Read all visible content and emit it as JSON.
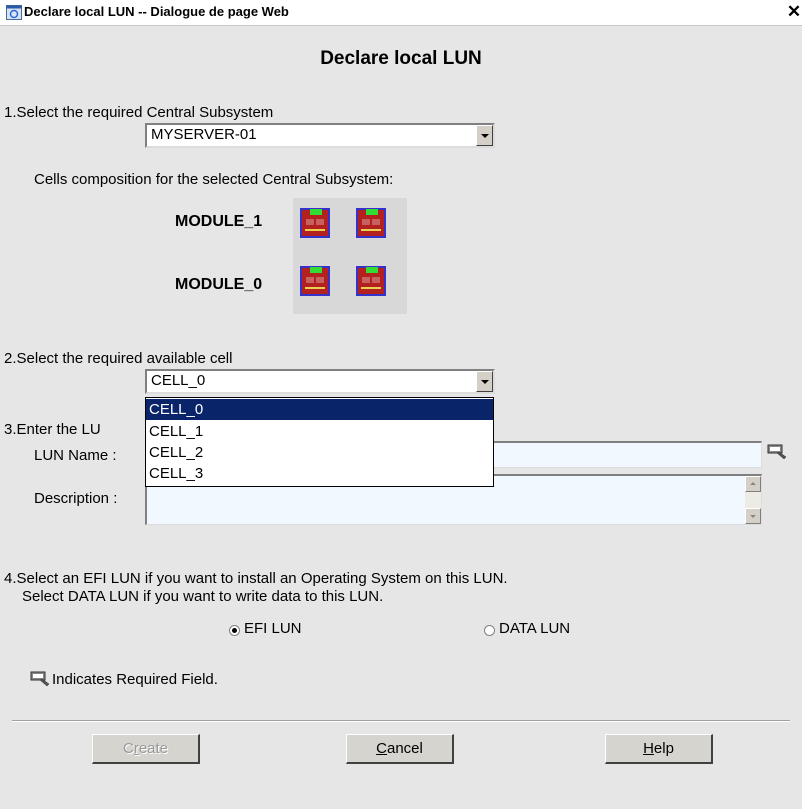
{
  "window": {
    "title": "Declare local LUN -- Dialogue de page Web"
  },
  "dialog": {
    "heading": "Declare local LUN"
  },
  "step1": {
    "label": "1.Select the required Central Subsystem",
    "selected": "MYSERVER-01",
    "composition_label": "Cells composition for the selected Central Subsystem:"
  },
  "modules": [
    {
      "name": "MODULE_1"
    },
    {
      "name": "MODULE_0"
    }
  ],
  "step2": {
    "label": "2.Select the required available cell",
    "selected": "CELL_0",
    "options": [
      "CELL_0",
      "CELL_1",
      "CELL_2",
      "CELL_3"
    ]
  },
  "step3": {
    "label_visible": "3.Enter the LU",
    "lun_name_label": "LUN Name :",
    "lun_name_value": "",
    "description_label": "Description :",
    "description_value": ""
  },
  "step4": {
    "line1": "4.Select an EFI LUN if you want to install an Operating System on this LUN.",
    "line2": "Select DATA LUN if you want to write data to this LUN.",
    "options": [
      {
        "label": "EFI LUN",
        "checked": true
      },
      {
        "label": "DATA LUN",
        "checked": false
      }
    ]
  },
  "required_note": "Indicates Required Field.",
  "buttons": {
    "create": {
      "prefix": "C",
      "underline": "r",
      "rest": "eate",
      "enabled": false
    },
    "cancel": {
      "underline": "C",
      "rest": "ancel",
      "enabled": true
    },
    "help": {
      "underline": "H",
      "rest": "elp",
      "enabled": true
    }
  },
  "icons": {
    "titlebar": "ie-window-icon",
    "cell": "cell-board-icon",
    "required": "required-field-icon"
  }
}
